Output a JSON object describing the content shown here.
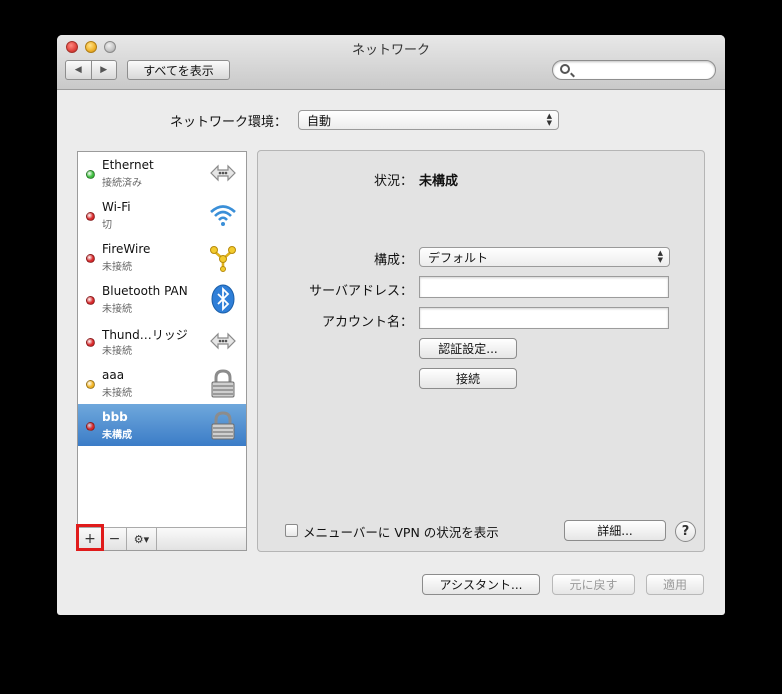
{
  "window": {
    "title": "ネットワーク",
    "show_all_label": "すべてを表示",
    "search_placeholder": ""
  },
  "location": {
    "label": "ネットワーク環境：",
    "value": "自動"
  },
  "services": [
    {
      "name": "Ethernet",
      "status": "接続済み",
      "dot_color": "#3dbd3d",
      "icon": "ethernet-icon"
    },
    {
      "name": "Wi-Fi",
      "status": "切",
      "dot_color": "#d8282a",
      "icon": "wifi-icon"
    },
    {
      "name": "FireWire",
      "status": "未接続",
      "dot_color": "#d8282a",
      "icon": "firewire-icon"
    },
    {
      "name": "Bluetooth PAN",
      "status": "未接続",
      "dot_color": "#d8282a",
      "icon": "bluetooth-icon"
    },
    {
      "name": "Thund…リッジ",
      "status": "未接続",
      "dot_color": "#d8282a",
      "icon": "thunderbolt-bridge-icon"
    },
    {
      "name": "aaa",
      "status": "未接続",
      "dot_color": "#f0b323",
      "icon": "lock-icon"
    },
    {
      "name": "bbb",
      "status": "未構成",
      "dot_color": "#d8282a",
      "icon": "lock-icon",
      "selected": true
    }
  ],
  "sidebar_toolbar": {
    "add": "+",
    "remove": "−",
    "action": "⚙▾"
  },
  "detail": {
    "status_label": "状況：",
    "status_value": "未構成",
    "config_label": "構成：",
    "config_value": "デフォルト",
    "server_label": "サーバアドレス：",
    "server_value": "",
    "account_label": "アカウント名：",
    "account_value": "",
    "auth_button": "認証設定...",
    "connect_button": "接続",
    "menubar_checkbox_label": "メニューバーに VPN の状況を表示",
    "advanced_button": "詳細...",
    "help": "?"
  },
  "footer": {
    "assistant": "アシスタント...",
    "revert": "元に戻す",
    "apply": "適用"
  }
}
